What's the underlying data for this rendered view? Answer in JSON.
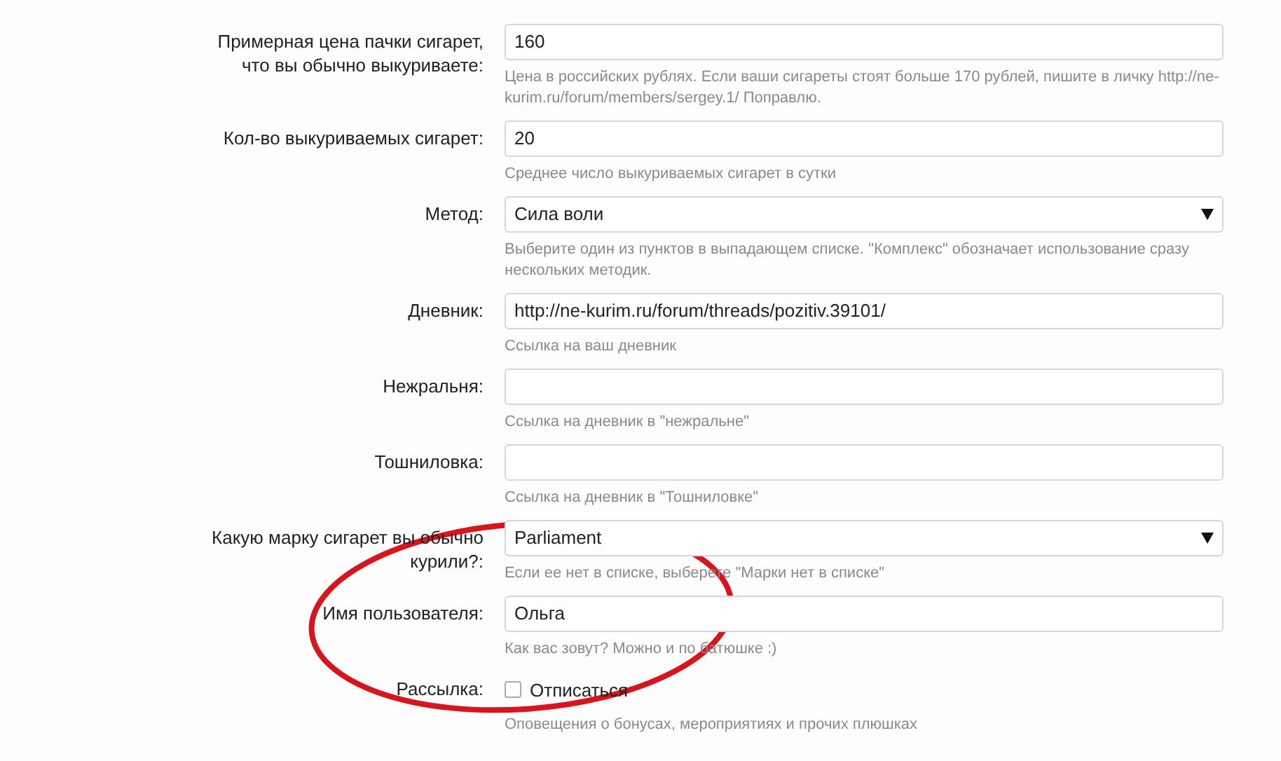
{
  "fields": [
    {
      "kind": "text",
      "label": "Примерная цена пачки сигарет, что вы обычно выкуриваете:",
      "value": "160",
      "hint": "Цена в российских рублях. Если ваши сигареты стоят больше 170 рублей, пишите в личку http://ne-kurim.ru/forum/members/sergey.1/ Поправлю."
    },
    {
      "kind": "text",
      "label": "Кол-во выкуриваемых сигарет:",
      "value": "20",
      "hint": "Среднее число выкуриваемых сигарет в сутки"
    },
    {
      "kind": "select",
      "label": "Метод:",
      "value": "Сила воли",
      "hint": "Выберите один из пунктов в выпадающем списке. \"Комплекс\" обозначает использование сразу нескольких методик."
    },
    {
      "kind": "text",
      "label": "Дневник:",
      "value": "http://ne-kurim.ru/forum/threads/pozitiv.39101/",
      "hint": "Ссылка на ваш дневник"
    },
    {
      "kind": "text",
      "label": "Нежральня:",
      "hint": "Ссылка на дневник в \"нежральне\""
    },
    {
      "kind": "text",
      "label": "Тошниловка:",
      "hint": "Ссылка на дневник в \"Тошниловке\""
    },
    {
      "kind": "select",
      "label": "Какую марку сигарет вы обычно курили?:",
      "value": "Parliament",
      "hint": "Если ее нет в списке, выберете \"Марки нет в списке\""
    },
    {
      "kind": "text",
      "label": "Имя пользователя:",
      "value": "Ольга",
      "hint": "Как вас зовут? Можно и по батюшке :)"
    },
    {
      "kind": "checkbox",
      "label": "Рассылка:",
      "value": "Отписаться",
      "checked": false,
      "hint": "Оповещения о бонусах, мероприятиях и прочих плюшках"
    }
  ]
}
